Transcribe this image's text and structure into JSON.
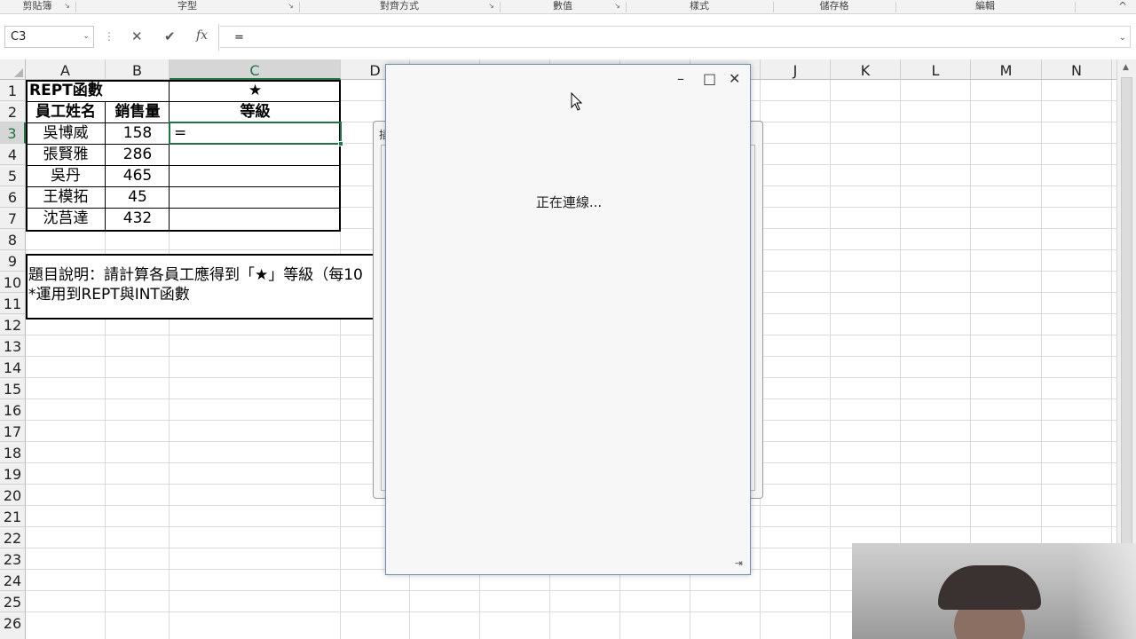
{
  "ribbon": {
    "groups": [
      "剪貼簿",
      "字型",
      "對齊方式",
      "數值",
      "樣式",
      "儲存格",
      "編輯"
    ],
    "launcher_glyph": "↘",
    "collapse_glyph": "^"
  },
  "formula_bar": {
    "name_box": "C3",
    "dots": "⋮",
    "cancel_glyph": "✕",
    "enter_glyph": "✔",
    "fx_glyph": "fx",
    "content": "=",
    "dropdown_glyph": "⌄"
  },
  "columns": [
    "A",
    "B",
    "C",
    "D",
    "E",
    "F",
    "G",
    "H",
    "I",
    "J",
    "K",
    "L",
    "M",
    "N"
  ],
  "rows": [
    "1",
    "2",
    "3",
    "4",
    "5",
    "6",
    "7",
    "8",
    "9",
    "10",
    "11",
    "12",
    "13",
    "14",
    "15",
    "16",
    "17",
    "18",
    "19",
    "20",
    "21",
    "22",
    "23",
    "24",
    "25",
    "26"
  ],
  "sheet": {
    "a1": "REPT函數",
    "c1": "★",
    "headers": [
      "員工姓名",
      "銷售量",
      "等級"
    ],
    "employees": [
      {
        "name": "吳博威",
        "sales": "158",
        "grade": "="
      },
      {
        "name": "張賢雅",
        "sales": "286",
        "grade": ""
      },
      {
        "name": "吳丹",
        "sales": "465",
        "grade": ""
      },
      {
        "name": "王模拓",
        "sales": "45",
        "grade": ""
      },
      {
        "name": "沈莒達",
        "sales": "432",
        "grade": ""
      }
    ],
    "note_line1": "題目說明：請計算各員工應得到「★」等級（每10",
    "note_line2": "*運用到REPT與INT函數"
  },
  "background_dialog": {
    "title_glyph": "插"
  },
  "popup": {
    "minimize_glyph": "–",
    "maximize_glyph": "□",
    "close_glyph": "✕",
    "message": "正在連線...",
    "grip_glyph": "⇥"
  },
  "scrollbar": {
    "up_glyph": "▲"
  }
}
